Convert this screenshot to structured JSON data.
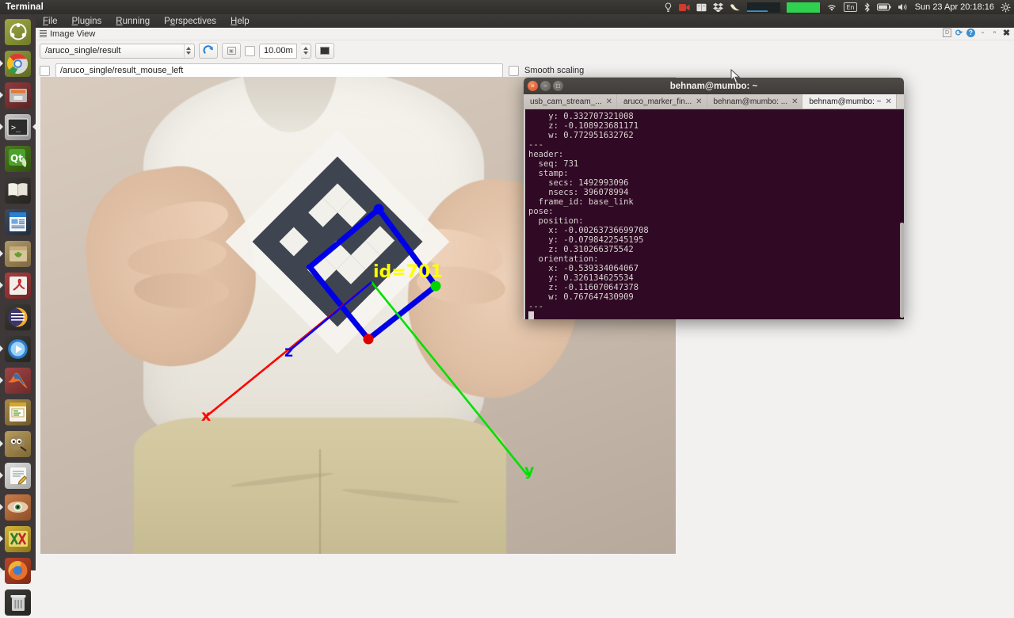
{
  "desktop": {
    "app_name": "Terminal",
    "clock": "Sun 23 Apr 20:18:16",
    "tray_icons": [
      "lightbulb-icon",
      "screen-record-icon",
      "dictionary-icon",
      "dropbox-icon",
      "banana-icon",
      "network-graph-icon",
      "cpu-graph-icon",
      "wifi-icon",
      "keyboard-layout-icon",
      "bluetooth-icon",
      "battery-icon",
      "volume-icon",
      "system-settings-icon"
    ],
    "keyboard_layout": "En"
  },
  "launcher": {
    "items": [
      {
        "name": "ubuntu-dash-icon",
        "label": "Dash home"
      },
      {
        "name": "chrome-icon",
        "label": "Google Chrome"
      },
      {
        "name": "files-icon",
        "label": "Files"
      },
      {
        "name": "terminal-icon",
        "label": "Terminal"
      },
      {
        "name": "qt-creator-icon",
        "label": "Qt Creator"
      },
      {
        "name": "dictionary-icon",
        "label": "Dictionary"
      },
      {
        "name": "libreoffice-writer-icon",
        "label": "LibreOffice Writer"
      },
      {
        "name": "software-updater-icon",
        "label": "Software Updater"
      },
      {
        "name": "pdf-reader-icon",
        "label": "PDF Reader"
      },
      {
        "name": "eclipse-icon",
        "label": "Eclipse"
      },
      {
        "name": "media-player-icon",
        "label": "Media Player"
      },
      {
        "name": "matlab-icon",
        "label": "MATLAB"
      },
      {
        "name": "libreoffice-impress-icon",
        "label": "LibreOffice Impress"
      },
      {
        "name": "gimp-icon",
        "label": "GIMP"
      },
      {
        "name": "text-editor-icon",
        "label": "Text Editor"
      },
      {
        "name": "eye-viewer-icon",
        "label": "Image Viewer"
      },
      {
        "name": "texmaker-icon",
        "label": "Texmaker"
      },
      {
        "name": "firefox-icon",
        "label": "Firefox"
      },
      {
        "name": "trash-icon",
        "label": "Trash"
      }
    ]
  },
  "rqt": {
    "menu": [
      {
        "label": "File",
        "mnemonic": "F"
      },
      {
        "label": "Plugins",
        "mnemonic": "P"
      },
      {
        "label": "Running",
        "mnemonic": "R"
      },
      {
        "label": "Perspectives",
        "mnemonic": "e"
      },
      {
        "label": "Help",
        "mnemonic": "H"
      }
    ],
    "panel": {
      "title": "Image View",
      "controls": [
        {
          "name": "dock-button",
          "glyph": "D"
        },
        {
          "name": "reload-button",
          "glyph": "⟳"
        },
        {
          "name": "help-button",
          "glyph": "?"
        },
        {
          "name": "minimize-button",
          "glyph": "-"
        },
        {
          "name": "maximize-button",
          "glyph": "▫"
        },
        {
          "name": "close-button",
          "glyph": "✖"
        }
      ]
    },
    "toolbar": {
      "topic": "/aruco_single/result",
      "max_range": "10.00m",
      "mouse_topic": "/aruco_single/result_mouse_left",
      "smooth_scaling_label": "Smooth scaling",
      "buttons": [
        {
          "name": "refresh-topics-button",
          "glyph": "⟳"
        },
        {
          "name": "save-image-button",
          "glyph": "❐"
        },
        {
          "name": "dynamic-range-checkbox",
          "glyph": ""
        },
        {
          "name": "color-scheme-button",
          "glyph": "■"
        }
      ]
    }
  },
  "image_view": {
    "marker": {
      "id_label": "id=701",
      "axis_x_label": "x",
      "axis_y_label": "y",
      "axis_z_label": "z",
      "axis_x_color": "#ff0000",
      "axis_y_color": "#00e000",
      "axis_z_color": "#0000ff",
      "outline_color": "#0000e6",
      "id_text_color": "#ffff00"
    }
  },
  "terminal": {
    "title": "behnam@mumbo: ~",
    "window_buttons": [
      {
        "name": "close-button",
        "glyph": "×"
      },
      {
        "name": "minimize-button",
        "glyph": "−"
      },
      {
        "name": "maximize-button",
        "glyph": "□"
      }
    ],
    "tabs": [
      {
        "label": "usb_cam_stream_...",
        "active": false
      },
      {
        "label": "aruco_marker_fin...",
        "active": false
      },
      {
        "label": "behnam@mumbo: ...",
        "active": false
      },
      {
        "label": "behnam@mumbo: ~",
        "active": true
      }
    ],
    "output_lines": [
      "    y: 0.332707321008",
      "    z: -0.108923681171",
      "    w: 0.772951632762",
      "---",
      "header: ",
      "  seq: 731",
      "  stamp: ",
      "    secs: 1492993096",
      "    nsecs: 396078994",
      "  frame_id: base_link",
      "pose: ",
      "  position: ",
      "    x: -0.00263736699708",
      "    y: -0.0798422545195",
      "    z: 0.310266375542",
      "  orientation: ",
      "    x: -0.539334064067",
      "    y: 0.326134625534",
      "    z: -0.116070647378",
      "    w: 0.767647430909",
      "---"
    ]
  }
}
